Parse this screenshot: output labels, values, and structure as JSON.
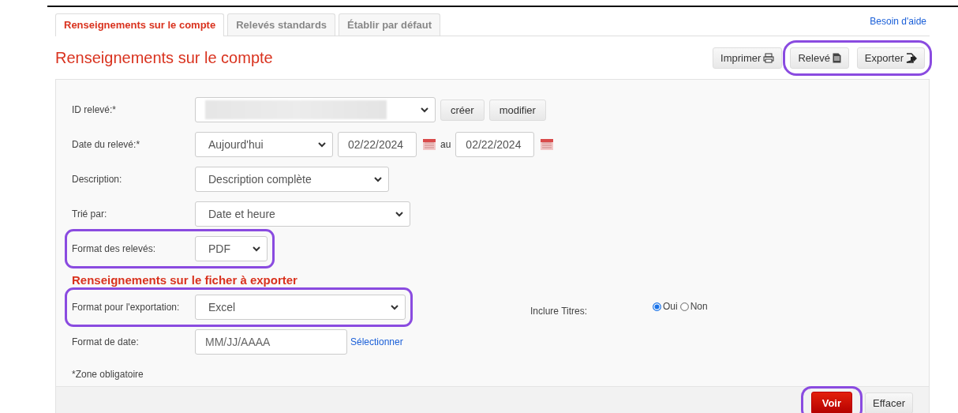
{
  "help_link": "Besoin d'aide",
  "tabs": [
    {
      "label": "Renseignements sur le compte",
      "selected": true
    },
    {
      "label": "Relevés standards",
      "selected": false
    },
    {
      "label": "Établir par défaut",
      "selected": false
    }
  ],
  "title": "Renseignements sur le compte",
  "toolbar": [
    {
      "label": "Imprimer",
      "highlighted": false
    },
    {
      "label": "Relevé",
      "highlighted": true
    },
    {
      "label": "Exporter",
      "highlighted": true
    }
  ],
  "fields": [
    {
      "kind": "select",
      "label": "ID relevé:*",
      "highlighted": false,
      "buttons": [
        "créer",
        "modifier"
      ]
    },
    {
      "kind": "daterange",
      "label": "Date du relevé:*",
      "value": "Aujourd'hui",
      "from": "02/22/2024",
      "separator": "au",
      "to": "02/22/2024",
      "highlighted": false
    },
    {
      "kind": "select",
      "label": "Description:",
      "value": "Description complète",
      "highlighted": false
    },
    {
      "kind": "select",
      "label": "Trié par:",
      "value": "Date et heure",
      "highlighted": false
    },
    {
      "kind": "select",
      "label": "Format des relevés:",
      "value": "PDF",
      "highlighted": true
    }
  ],
  "export_section": {
    "heading": "Renseignements sur le ficher à exporter",
    "fields": [
      {
        "kind": "select",
        "label": "Format pour l'exportation:",
        "value": "Excel",
        "highlighted": true
      },
      {
        "kind": "input",
        "label": "Format de date:",
        "placeholder": "MM/JJ/AAAA",
        "link": "Sélectionner",
        "highlighted": false
      }
    ],
    "titles": {
      "label": "Inclure Titres:",
      "options": [
        {
          "label": "Oui",
          "selected": true
        },
        {
          "label": "Non",
          "selected": false
        }
      ]
    }
  },
  "required_note": "*Zone obligatoire",
  "footer_buttons": [
    {
      "label": "Voir",
      "kind": "primary",
      "highlighted": true
    },
    {
      "label": "Effacer",
      "kind": "secondary",
      "highlighted": false
    }
  ]
}
